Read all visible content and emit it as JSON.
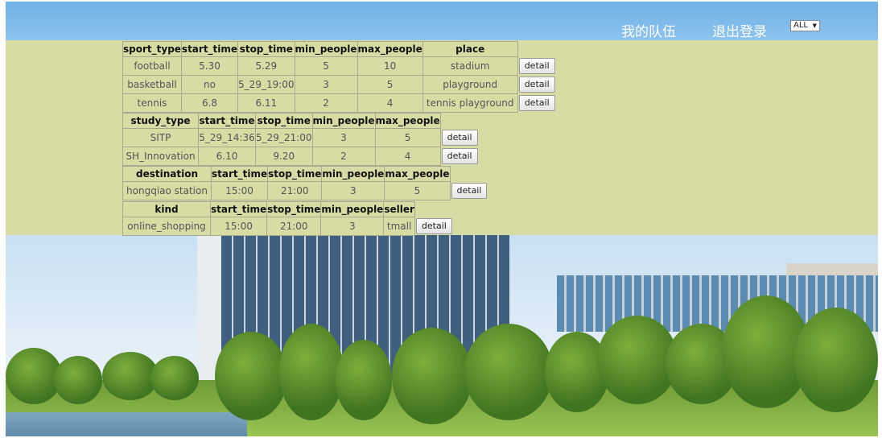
{
  "header": {
    "nav_team": "我的队伍",
    "nav_logout": "退出登录",
    "filter": {
      "selected": "ALL"
    }
  },
  "detail_label": "detail",
  "sports": {
    "headers": [
      "sport_type",
      "start_time",
      "stop_time",
      "min_people",
      "max_people",
      "place"
    ],
    "rows": [
      [
        "football",
        "5.30",
        "5.29",
        "5",
        "10",
        "stadium"
      ],
      [
        "basketball",
        "no",
        "5_29_19:00",
        "3",
        "5",
        "playground"
      ],
      [
        "tennis",
        "6.8",
        "6.11",
        "2",
        "4",
        "tennis playground"
      ]
    ]
  },
  "study": {
    "headers": [
      "study_type",
      "start_time",
      "stop_time",
      "min_people",
      "max_people"
    ],
    "rows": [
      [
        "SITP",
        "5_29_14:36",
        "5_29_21:00",
        "3",
        "5"
      ],
      [
        "SH_Innovation",
        "6.10",
        "9.20",
        "2",
        "4"
      ]
    ]
  },
  "trip": {
    "headers": [
      "destination",
      "start_time",
      "stop_time",
      "min_people",
      "max_people"
    ],
    "rows": [
      [
        "hongqiao station",
        "15:00",
        "21:00",
        "3",
        "5"
      ]
    ]
  },
  "shopping": {
    "headers": [
      "kind",
      "start_time",
      "stop_time",
      "min_people",
      "seller"
    ],
    "rows": [
      [
        "online_shopping",
        "15:00",
        "21:00",
        "3",
        "tmall"
      ]
    ]
  }
}
